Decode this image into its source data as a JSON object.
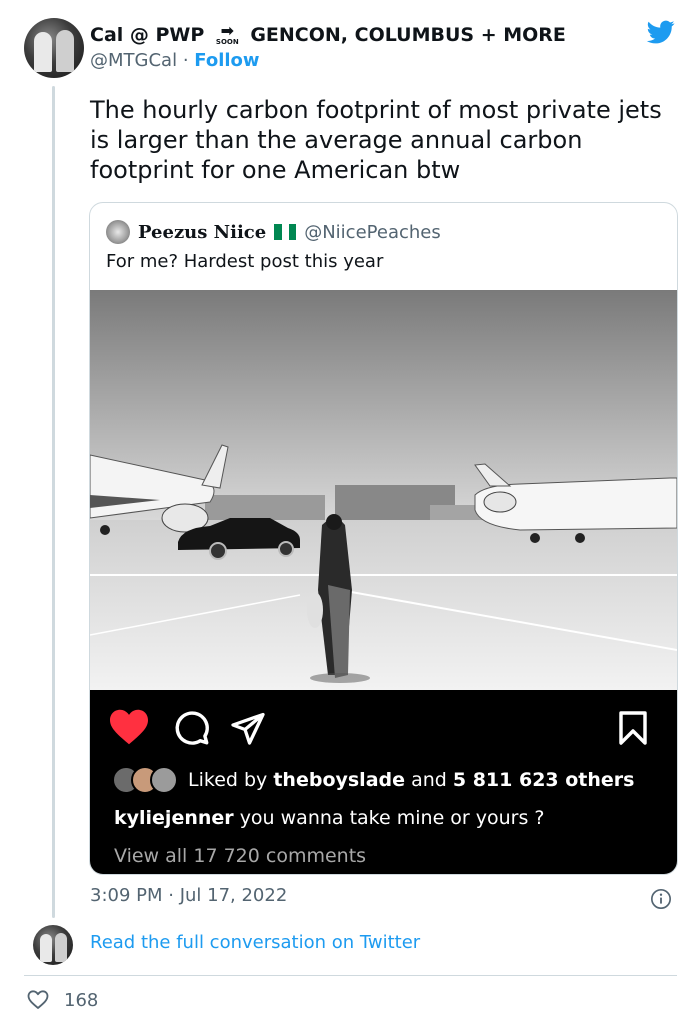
{
  "tweet": {
    "author": {
      "name_part1": "Cal @ PWP",
      "soon_badge": "SOON",
      "name_part2": "GENCON, COLUMBUS + MORE",
      "handle": "@MTGCal",
      "separator": "·",
      "follow_label": "Follow"
    },
    "text": "The hourly carbon footprint of most private jets is larger than the average annual carbon footprint for one American btw",
    "quoted": {
      "name": "Peezus Niice",
      "handle": "@NiicePeaches",
      "text": "For me? Hardest post this year",
      "instagram": {
        "liked_prefix": "Liked by",
        "liked_user": "theboyslade",
        "liked_mid": "and",
        "liked_count": "5 811 623 others",
        "caption_user": "kyliejenner",
        "caption_text": "you wanna take mine or yours ?",
        "comments_link": "View all 17 720 comments"
      }
    },
    "timestamp": "3:09 PM · Jul 17, 2022",
    "read_link": "Read the full conversation on Twitter",
    "like_count": "168"
  },
  "icons": {
    "twitter": "twitter-bird-icon",
    "info": "info-icon",
    "heart": "heart-outline-icon"
  },
  "colors": {
    "accent": "#1d9bf0",
    "text": "#0f1419",
    "muted": "#536471",
    "border": "#cfd9de",
    "ig_heart": "#ff3040",
    "flag_green": "#008751"
  }
}
